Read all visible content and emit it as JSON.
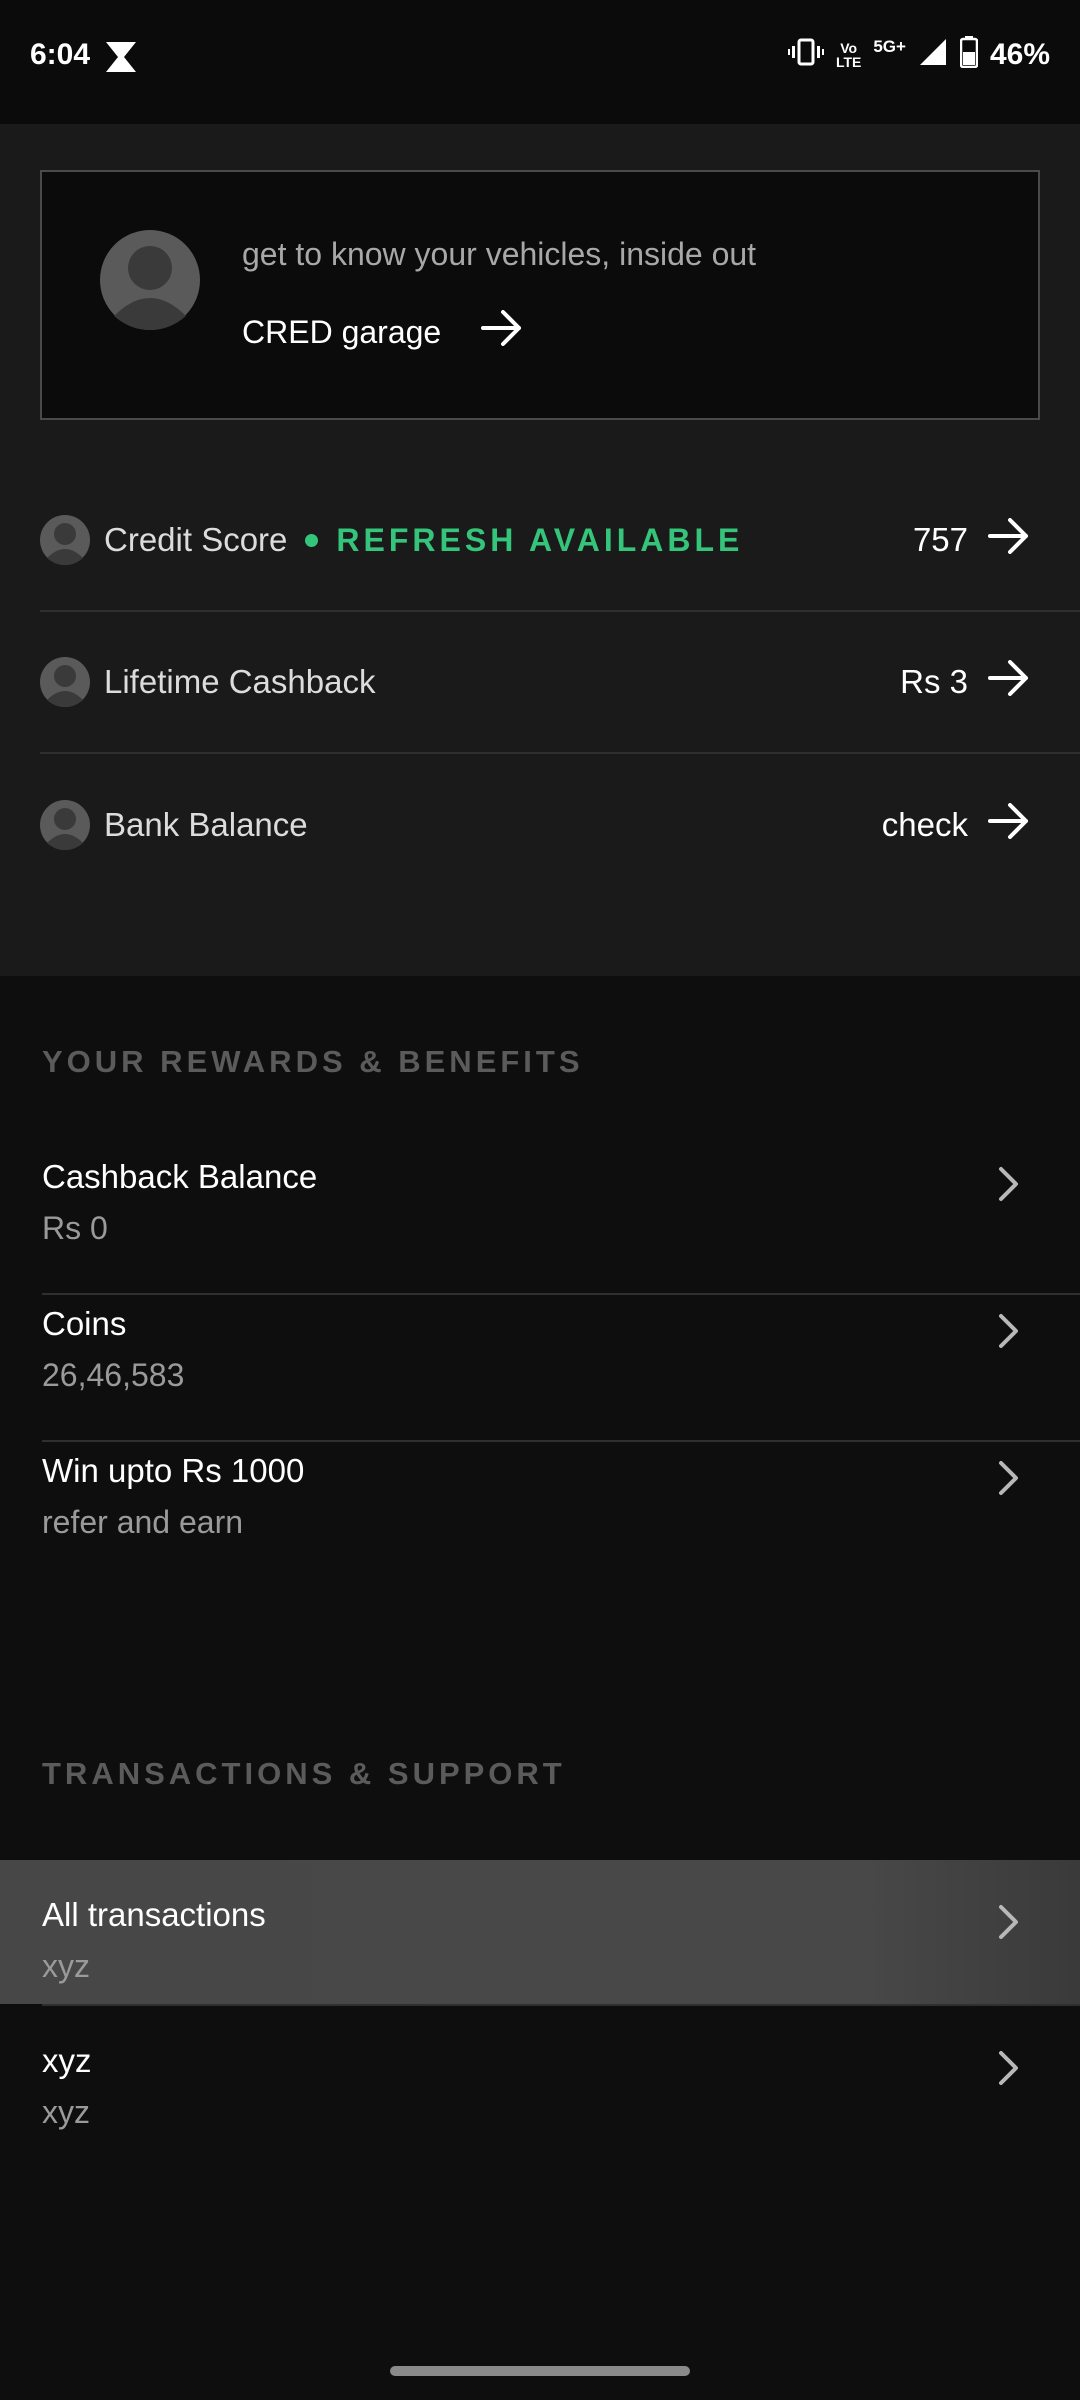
{
  "status_bar": {
    "time": "6:04",
    "network_top": "Vo",
    "network_bottom": "LTE",
    "network_5g": "5G+",
    "battery": "46%"
  },
  "garage": {
    "subtitle": "get to know your vehicles, inside out",
    "link_label": "CRED garage"
  },
  "info_rows": {
    "credit_score": {
      "label": "Credit Score",
      "badge": "REFRESH AVAILABLE",
      "value": "757"
    },
    "lifetime_cashback": {
      "label": "Lifetime Cashback",
      "value": "Rs 3"
    },
    "bank_balance": {
      "label": "Bank Balance",
      "value": "check"
    }
  },
  "rewards": {
    "header": "YOUR REWARDS & BENEFITS",
    "items": [
      {
        "title": "Cashback Balance",
        "subtitle": "Rs 0"
      },
      {
        "title": "Coins",
        "subtitle": "26,46,583"
      },
      {
        "title": "Win upto Rs 1000",
        "subtitle": "refer and earn"
      }
    ]
  },
  "transactions": {
    "header": "TRANSACTIONS & SUPPORT",
    "items": [
      {
        "title": "All transactions",
        "subtitle": "xyz"
      },
      {
        "title": "xyz",
        "subtitle": "xyz"
      }
    ]
  },
  "colors": {
    "accent_green": "#34c47a",
    "background": "#0e0e0e",
    "panel": "#1a1a1a"
  },
  "icons": [
    "hourglass-icon",
    "vibrate-icon",
    "signal-icon",
    "battery-icon",
    "avatar-icon",
    "arrow-right-icon",
    "chevron-right-icon"
  ]
}
